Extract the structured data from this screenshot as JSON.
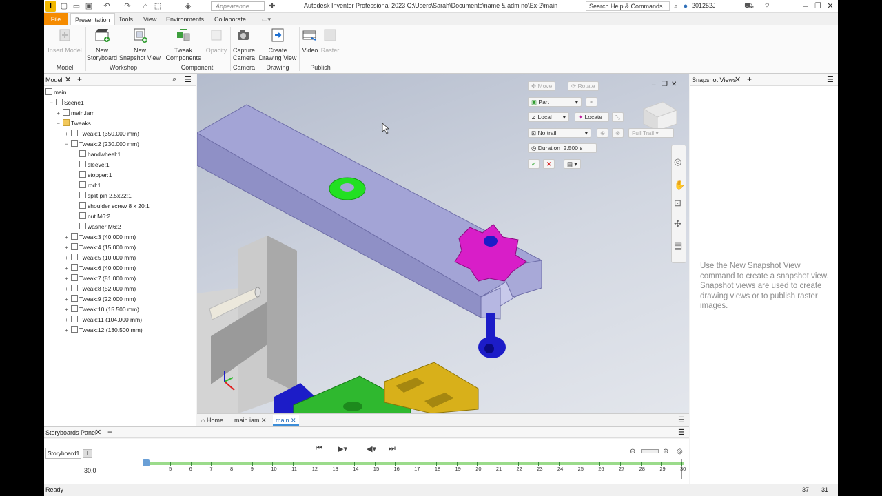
{
  "title_bar": {
    "appearance_placeholder": "Appearance",
    "title": "Autodesk Inventor Professional 2023    C:\\Users\\Sarah\\Documents\\name & adm no\\Ex-2\\main",
    "search_placeholder": "Search Help & Commands...",
    "user": "201252J"
  },
  "ribbon_tabs": [
    "File",
    "Presentation",
    "Tools",
    "View",
    "Environments",
    "Collaborate"
  ],
  "ribbon": {
    "buttons": [
      {
        "label": "Insert Model",
        "enabled": false
      },
      {
        "label": "New\nStoryboard",
        "enabled": true
      },
      {
        "label": "New\nSnapshot View",
        "enabled": true
      },
      {
        "label": "Tweak\nComponents",
        "enabled": true
      },
      {
        "label": "Opacity",
        "enabled": false
      },
      {
        "label": "Capture\nCamera",
        "enabled": true
      },
      {
        "label": "Create\nDrawing View",
        "enabled": true
      },
      {
        "label": "Video",
        "enabled": true
      },
      {
        "label": "Raster",
        "enabled": false
      }
    ],
    "groups": [
      "Model",
      "Workshop",
      "Component",
      "Camera",
      "Drawing",
      "Publish"
    ]
  },
  "model_panel": {
    "tab": "Model",
    "tree": [
      {
        "label": "main",
        "level": 0,
        "expander": ""
      },
      {
        "label": "Scene1",
        "level": 1,
        "expander": "−"
      },
      {
        "label": "main.iam",
        "level": 2,
        "expander": "+"
      },
      {
        "label": "Tweaks",
        "level": 2,
        "expander": "−",
        "folder": true
      },
      {
        "label": "Tweak:1 (350.000 mm)",
        "level": 3,
        "expander": "+"
      },
      {
        "label": "Tweak:2 (230.000 mm)",
        "level": 3,
        "expander": "−"
      },
      {
        "label": "handwheel:1",
        "level": 4,
        "expander": ""
      },
      {
        "label": "sleeve:1",
        "level": 4,
        "expander": ""
      },
      {
        "label": "stopper:1",
        "level": 4,
        "expander": ""
      },
      {
        "label": "rod:1",
        "level": 4,
        "expander": ""
      },
      {
        "label": "split pin 2,5x22:1",
        "level": 4,
        "expander": ""
      },
      {
        "label": "shoulder screw 8 x 20:1",
        "level": 4,
        "expander": ""
      },
      {
        "label": "nut M6:2",
        "level": 4,
        "expander": ""
      },
      {
        "label": "washer M6:2",
        "level": 4,
        "expander": ""
      },
      {
        "label": "Tweak:3 (40.000 mm)",
        "level": 3,
        "expander": "+"
      },
      {
        "label": "Tweak:4 (15.000 mm)",
        "level": 3,
        "expander": "+"
      },
      {
        "label": "Tweak:5 (10.000 mm)",
        "level": 3,
        "expander": "+"
      },
      {
        "label": "Tweak:6 (40.000 mm)",
        "level": 3,
        "expander": "+"
      },
      {
        "label": "Tweak:7 (81.000 mm)",
        "level": 3,
        "expander": "+"
      },
      {
        "label": "Tweak:8 (52.000 mm)",
        "level": 3,
        "expander": "+"
      },
      {
        "label": "Tweak:9 (22.000 mm)",
        "level": 3,
        "expander": "+"
      },
      {
        "label": "Tweak:10 (15.500 mm)",
        "level": 3,
        "expander": "+"
      },
      {
        "label": "Tweak:11 (104.000 mm)",
        "level": 3,
        "expander": "+"
      },
      {
        "label": "Tweak:12 (130.500 mm)",
        "level": 3,
        "expander": "+"
      }
    ]
  },
  "tweak_toolbar": {
    "move": "Move",
    "rotate": "Rotate",
    "part": "Part",
    "local": "Local",
    "locate": "Locate",
    "trail": "No trail",
    "full_trail": "Full Trail",
    "duration_label": "Duration",
    "duration_value": "2.500 s"
  },
  "doc_tabs": [
    "Home",
    "main.iam",
    "main"
  ],
  "snapshot_panel": {
    "tab": "Snapshot Views",
    "message": "Use the New Snapshot View command to create a snapshot view. Snapshot views are used to create drawing views or to publish raster images."
  },
  "storyboard": {
    "panel_tab": "Storyboards Panel",
    "tab": "Storyboard1",
    "current_time": "30.0",
    "ticks": [
      "5",
      "6",
      "7",
      "8",
      "9",
      "10",
      "11",
      "12",
      "13",
      "14",
      "15",
      "16",
      "17",
      "18",
      "19",
      "20",
      "21",
      "22",
      "23",
      "24",
      "25",
      "26",
      "27",
      "28",
      "29",
      "30"
    ]
  },
  "status": {
    "text": "Ready",
    "num1": "37",
    "num2": "31"
  },
  "colors": {
    "accent": "#f58b00",
    "beam": "#9c9ccc",
    "handwheel": "#d81ec8",
    "washer": "#2fe02f",
    "rod": "#1c1cc8",
    "block_gray": "#c9c9c9",
    "yellow_block": "#d8b01a",
    "green_block": "#2fb82f"
  }
}
